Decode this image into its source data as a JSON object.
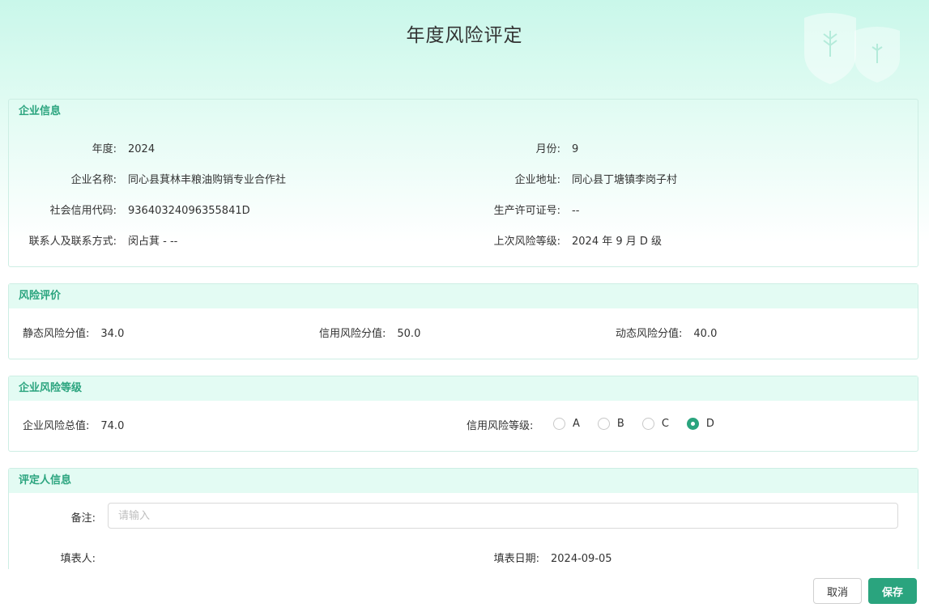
{
  "title": "年度风险评定",
  "company_info": {
    "heading": "企业信息",
    "year_label": "年度:",
    "year_value": "2024",
    "month_label": "月份:",
    "month_value": "9",
    "name_label": "企业名称:",
    "name_value": "同心县萁林丰粮油购销专业合作社",
    "address_label": "企业地址:",
    "address_value": "同心县丁塘镇李岗子村",
    "credit_code_label": "社会信用代码:",
    "credit_code_value": "93640324096355841D",
    "license_label": "生产许可证号:",
    "license_value": "--",
    "contact_label": "联系人及联系方式:",
    "contact_value": "闵占萁 - --",
    "last_level_label": "上次风险等级:",
    "last_level_value": "2024 年 9 月 D 级"
  },
  "risk_evaluation": {
    "heading": "风险评价",
    "static_label": "静态风险分值:",
    "static_value": "34.0",
    "credit_label": "信用风险分值:",
    "credit_value": "50.0",
    "dynamic_label": "动态风险分值:",
    "dynamic_value": "40.0"
  },
  "risk_level": {
    "heading": "企业风险等级",
    "total_label": "企业风险总值:",
    "total_value": "74.0",
    "credit_level_label": "信用风险等级:",
    "options": [
      "A",
      "B",
      "C",
      "D"
    ],
    "selected": "D"
  },
  "evaluator": {
    "heading": "评定人信息",
    "remark_label": "备注:",
    "remark_placeholder": "请输入",
    "remark_value": "",
    "filler_label": "填表人:",
    "filler_value": "",
    "date_label": "填表日期:",
    "date_value": "2024-09-05"
  },
  "footer": {
    "cancel_label": "取消",
    "save_label": "保存"
  },
  "colors": {
    "accent": "#2aa47e",
    "header_bg": "#e3fbf3",
    "top_gradient": "#c9f7ea"
  },
  "icons": {
    "watermark": "shield-wheat-icon"
  }
}
